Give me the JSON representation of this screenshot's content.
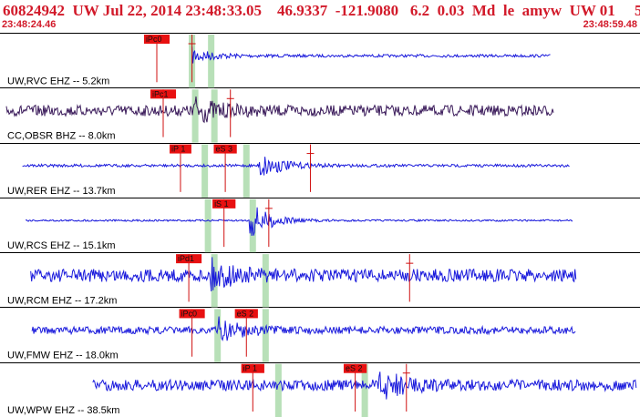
{
  "header": {
    "title": "60824942  UW Jul 22, 2014 23:48:33.05    46.9337  -121.9080   6.2  0.03  Md  le  amyw  UW 01     5",
    "time_start": "23:48:24.46",
    "time_end": "23:48:59.48",
    "title_color": "#d21a2a"
  },
  "colors": {
    "trace": "#1a1adc",
    "trace_dark": "#3a1a5a",
    "pick_box": "#e81010",
    "pick_line": "#d01010",
    "window": "#b8e0b8",
    "grid": "#000000"
  },
  "traces": [
    {
      "label": "UW,RVC EHZ -- 5.2km",
      "color": "#1a1adc",
      "amp": 1.5,
      "xs": 0.3,
      "xe": 0.86,
      "onset": 0.285,
      "burst": 14,
      "picks": [
        {
          "text": "iPc0",
          "x": 0.245,
          "w": 0.04
        },
        {
          "text": "",
          "x": 0.3,
          "w": 0.0
        }
      ],
      "windows": [
        0.295,
        0.325
      ]
    },
    {
      "label": "CC,OBSR BHZ -- 8.0km",
      "color": "#3a1a5a",
      "amp": 6,
      "xs": 0.01,
      "xe": 0.865,
      "onset": 0.3,
      "burst": 15,
      "picks": [
        {
          "text": "iPc1",
          "x": 0.255,
          "w": 0.04
        },
        {
          "text": "",
          "x": 0.36,
          "w": 0.0
        }
      ],
      "windows": [
        0.3,
        0.33
      ]
    },
    {
      "label": "UW,RER EHZ -- 13.7km",
      "color": "#1a1adc",
      "amp": 1.5,
      "xs": 0.035,
      "xe": 0.89,
      "onset": 0.405,
      "burst": 16,
      "picks": [
        {
          "text": "iP 1",
          "x": 0.282,
          "w": 0.034
        },
        {
          "text": "eS 3",
          "x": 0.352,
          "w": 0.036
        },
        {
          "text": "",
          "x": 0.485,
          "w": 0.0
        }
      ],
      "windows": [
        0.315,
        0.38
      ]
    },
    {
      "label": "UW,RCS EHZ -- 15.1km",
      "color": "#1a1adc",
      "amp": 1.0,
      "xs": 0.04,
      "xe": 0.895,
      "onset": 0.39,
      "burst": 20,
      "picks": [
        {
          "text": "iS 1",
          "x": 0.35,
          "w": 0.036
        },
        {
          "text": "",
          "x": 0.42,
          "w": 0.0
        }
      ],
      "windows": [
        0.32,
        0.39
      ]
    },
    {
      "label": "UW,RCM EHZ -- 17.2km",
      "color": "#1a1adc",
      "amp": 7,
      "xs": 0.048,
      "xe": 0.9,
      "onset": 0.33,
      "burst": 14,
      "picks": [
        {
          "text": "iPd1",
          "x": 0.295,
          "w": 0.04
        },
        {
          "text": "",
          "x": 0.64,
          "w": 0.0
        }
      ],
      "windows": [
        0.33,
        0.41
      ]
    },
    {
      "label": "UW,FMW EHZ -- 18.0km",
      "color": "#1a1adc",
      "amp": 4,
      "xs": 0.05,
      "xe": 0.9,
      "onset": 0.34,
      "burst": 15,
      "picks": [
        {
          "text": "iPc0",
          "x": 0.3,
          "w": 0.04
        },
        {
          "text": "eS 2",
          "x": 0.385,
          "w": 0.036
        }
      ],
      "windows": [
        0.335,
        0.41
      ]
    },
    {
      "label": "UW,WPW EHZ -- 38.5km",
      "color": "#1a1adc",
      "amp": 6,
      "xs": 0.145,
      "xe": 0.995,
      "onset": 0.59,
      "burst": 18,
      "picks": [
        {
          "text": "iP 1",
          "x": 0.395,
          "w": 0.036
        },
        {
          "text": "eS 2",
          "x": 0.555,
          "w": 0.036
        },
        {
          "text": "",
          "x": 0.635,
          "w": 0.0
        }
      ],
      "windows": [
        0.43,
        0.565
      ]
    }
  ]
}
